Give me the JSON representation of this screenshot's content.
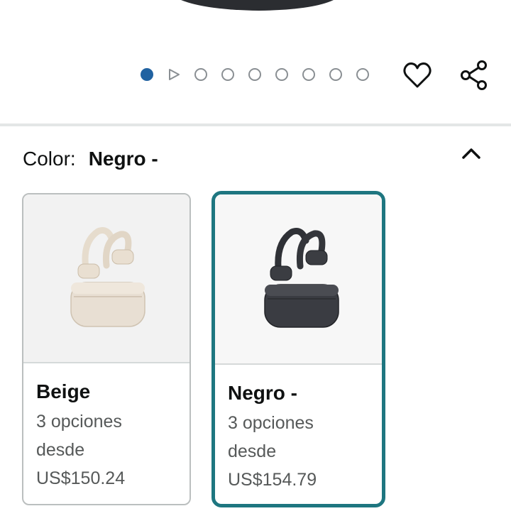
{
  "carousel": {
    "dot_count": 9,
    "active_index": 0,
    "video_index": 1
  },
  "actions": {
    "wishlist_icon": "heart-icon",
    "share_icon": "share-icon"
  },
  "color_selector": {
    "label": "Color:",
    "selected_value": "Negro -",
    "collapse_icon": "chevron-up-icon"
  },
  "swatches": [
    {
      "name": "Beige",
      "options": "3 opciones",
      "from": "desde",
      "price": "US$150.24",
      "selected": false
    },
    {
      "name": "Negro -",
      "options": "3 opciones",
      "from": "desde",
      "price": "US$154.79",
      "selected": true
    }
  ],
  "colors": {
    "active_dot": "#2162a1",
    "selected_border": "#1e7680",
    "muted_text": "#565959"
  }
}
